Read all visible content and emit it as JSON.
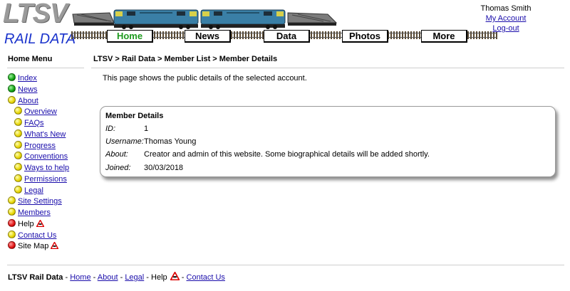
{
  "header": {
    "logo_top": "LTSV",
    "logo_bottom": "RAIL DATA",
    "nav": [
      {
        "label": "Home",
        "active": true
      },
      {
        "label": "News",
        "active": false
      },
      {
        "label": "Data",
        "active": false
      },
      {
        "label": "Photos",
        "active": false
      },
      {
        "label": "More",
        "active": false
      }
    ],
    "user": {
      "name": "Thomas Smith",
      "account": "My Account",
      "logout": "Log-out"
    }
  },
  "sidebar": {
    "title": "Home Menu",
    "items": [
      {
        "label": "Index",
        "color": "green",
        "link": true
      },
      {
        "label": "News",
        "color": "green",
        "link": true
      },
      {
        "label": "About",
        "color": "yellow",
        "link": true
      },
      {
        "label": "Overview",
        "color": "yellow",
        "link": true
      },
      {
        "label": "FAQs",
        "color": "yellow",
        "link": true
      },
      {
        "label": "What's New",
        "color": "yellow",
        "link": true
      },
      {
        "label": "Progress",
        "color": "yellow",
        "link": true
      },
      {
        "label": "Conventions",
        "color": "yellow",
        "link": true
      },
      {
        "label": "Ways to help",
        "color": "yellow",
        "link": true
      },
      {
        "label": "Permissions",
        "color": "yellow",
        "link": true
      },
      {
        "label": "Legal",
        "color": "yellow",
        "link": true
      },
      {
        "label": "Site Settings",
        "color": "yellow",
        "link": true
      },
      {
        "label": "Members",
        "color": "yellow",
        "link": true
      },
      {
        "label": "Help",
        "color": "red",
        "link": false,
        "warning": true
      },
      {
        "label": "Contact Us",
        "color": "yellow",
        "link": true
      },
      {
        "label": "Site Map",
        "color": "red",
        "link": false,
        "warning": true
      }
    ]
  },
  "main": {
    "breadcrumb": "LTSV > Rail Data > Member List > Member Details",
    "intro": "This page shows the public details of the selected account.",
    "card": {
      "title": "Member Details",
      "rows": [
        {
          "key": "ID:",
          "value": "1"
        },
        {
          "key": "Username:",
          "value": "Thomas Young"
        },
        {
          "key": "About:",
          "value": "Creator and admin of this website. Some biographical details will be added shortly."
        },
        {
          "key": "Joined:",
          "value": "30/03/2018"
        }
      ]
    }
  },
  "footer": {
    "brand": "LTSV Rail Data",
    "sep": "-",
    "links": [
      "Home",
      "About",
      "Legal"
    ],
    "help": "Help",
    "contact": "Contact Us"
  },
  "colors": {
    "link": "#1a0dab",
    "logo_blue": "#1a33cc",
    "active_nav": "#1e9a1e",
    "loco_body": "#3a7fa6"
  }
}
